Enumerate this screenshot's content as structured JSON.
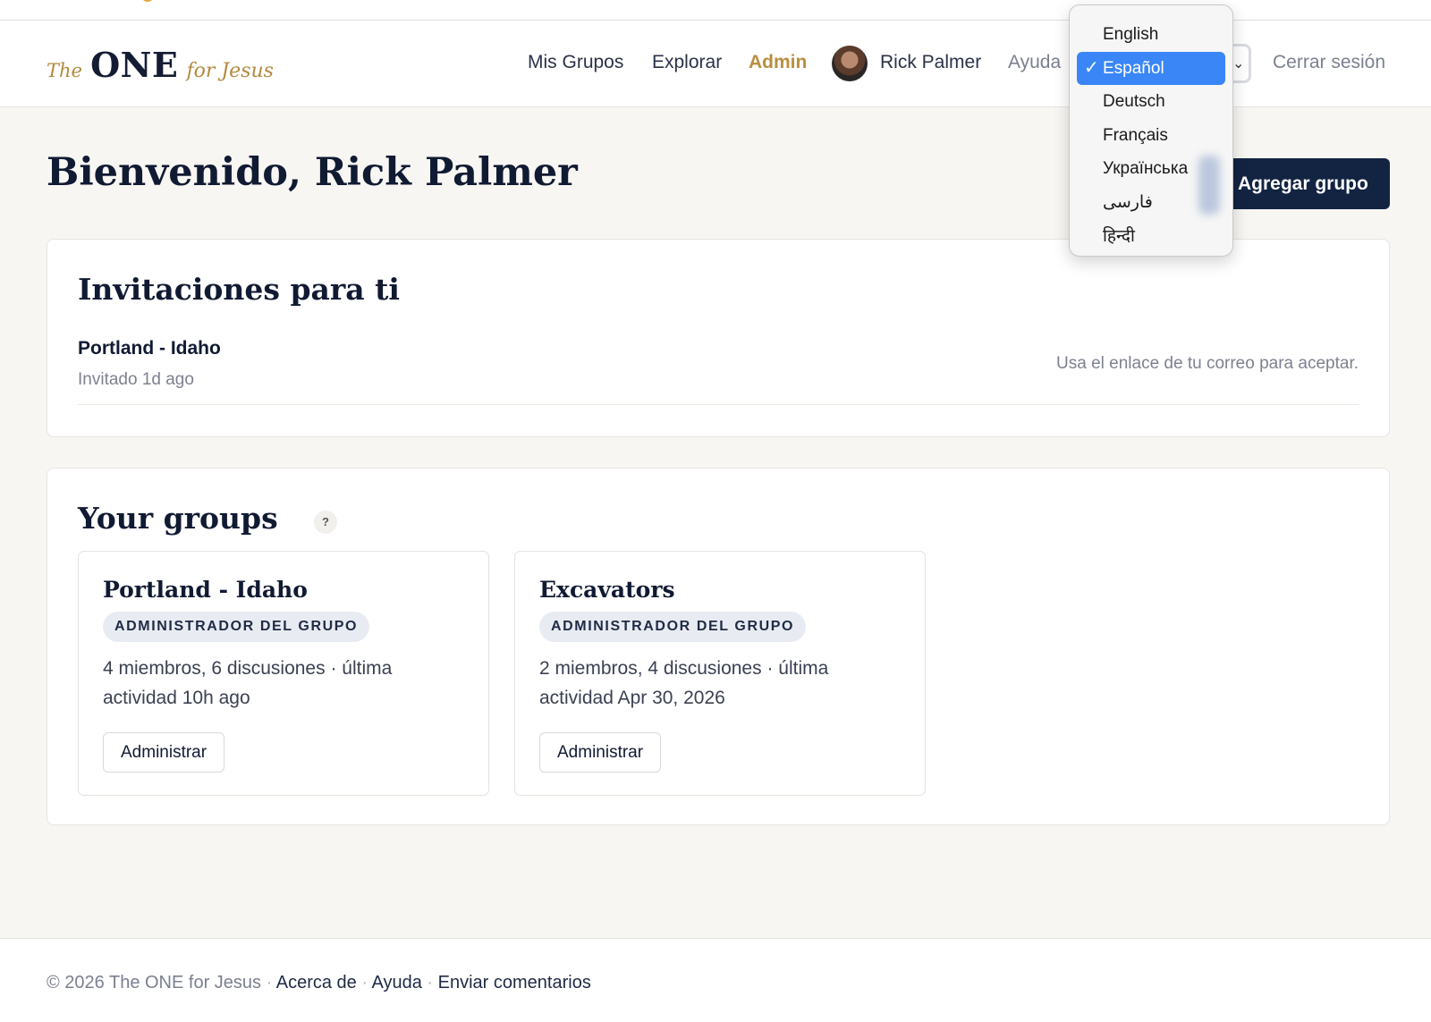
{
  "logo": {
    "the": "The",
    "one": "ONE",
    "for_jesus": "for Jesus"
  },
  "nav": {
    "my_groups": "Mis Grupos",
    "explore": "Explorar",
    "admin": "Admin",
    "user_name": "Rick Palmer",
    "help": "Ayuda",
    "logout": "Cerrar sesión"
  },
  "language_menu": {
    "selected": "Español",
    "options": [
      "English",
      "Español",
      "Deutsch",
      "Français",
      "Українська",
      "فارسی",
      "हिन्दी"
    ]
  },
  "page": {
    "title": "Bienvenido, Rick Palmer",
    "add_group_button": "Agregar grupo"
  },
  "invitations": {
    "heading": "Invitaciones para ti",
    "items": [
      {
        "group": "Portland - Idaho",
        "meta": "Invitado 1d ago",
        "hint": "Usa el enlace de tu correo para aceptar."
      }
    ]
  },
  "groups": {
    "heading": "Your groups",
    "help_badge": "?",
    "items": [
      {
        "name": "Portland - Idaho",
        "role": "ADMINISTRADOR DEL GRUPO",
        "stats": "4 miembros, 6 discusiones · última actividad 10h ago",
        "manage": "Administrar"
      },
      {
        "name": "Excavators",
        "role": "ADMINISTRADOR DEL GRUPO",
        "stats": "2 miembros, 4 discusiones · última actividad Apr 30, 2026",
        "manage": "Administrar"
      }
    ]
  },
  "footer": {
    "copyright": "© 2026 The ONE for Jesus",
    "separator": "·",
    "about": "Acerca de",
    "help": "Ayuda",
    "feedback": "Enviar comentarios"
  },
  "colors": {
    "brand_navy": "#132443",
    "brand_gold": "#b98f3f",
    "selection_blue": "#3a86f6",
    "page_bg": "#f7f6f2"
  }
}
